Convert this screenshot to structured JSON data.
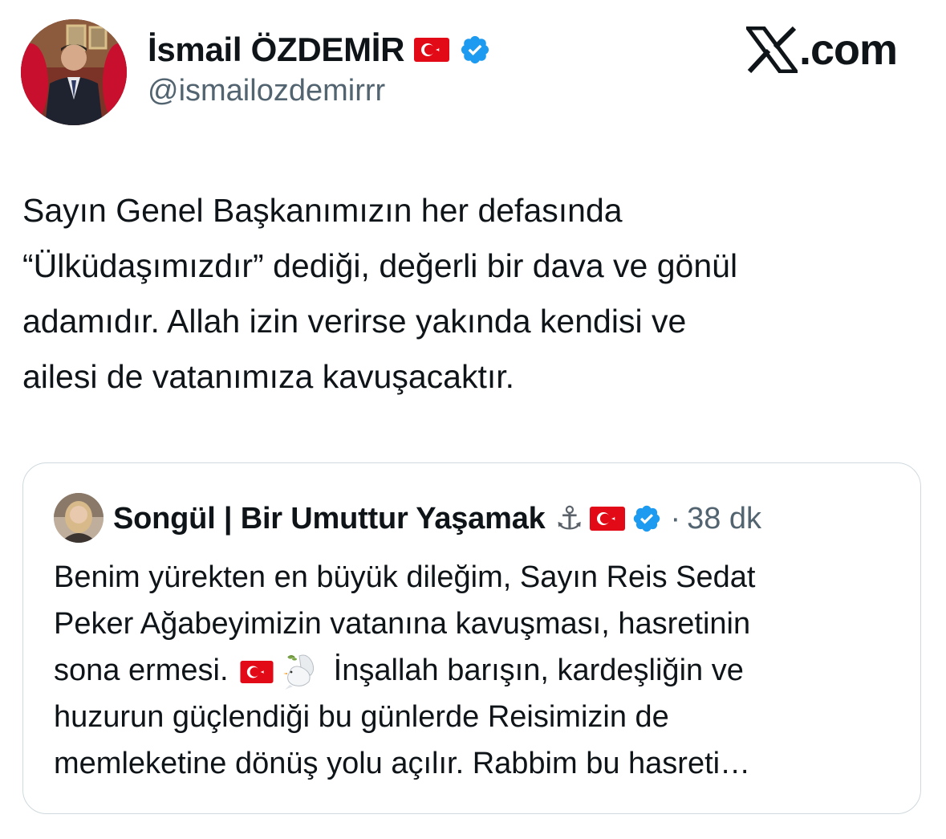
{
  "author": {
    "display_name": "İsmail ÖZDEMİR",
    "handle": "@ismailozdemirrr",
    "flag_icon": "turkey-flag-icon",
    "verified_icon": "verified-badge-icon",
    "verified_color": "#1d9bf0"
  },
  "brand": {
    "logo_icon": "x-logo-icon",
    "text": ".com"
  },
  "tweet": {
    "lines": [
      "Sayın Genel Başkanımızın her defasında",
      "“Ülküdaşımızdır” dediği, değerli bir dava ve gönül",
      "adamıdır. Allah izin verirse yakında kendisi ve",
      "ailesi de vatanımıza kavuşacaktır."
    ]
  },
  "quoted": {
    "display_name": "Songül | Bir Umuttur Yaşamak",
    "anchor_emoji": "⚓",
    "flag_icon": "turkey-flag-icon",
    "verified_icon": "verified-badge-icon",
    "separator": "·",
    "time": "38 dk",
    "line1": "Benim yürekten en büyük dileğim, Sayın Reis Sedat",
    "line2": "Peker Ağabeyimizin vatanına kavuşması, hasretinin",
    "line3_a": "sona ermesi.",
    "line3_emojis": [
      "turkey-flag-icon",
      "dove-icon"
    ],
    "line3_b": "İnşallah barışın, kardeşliğin ve",
    "line4": "huzurun güçlendiği bu günlerde Reisimizin de",
    "line5": "memleketine dönüş yolu açılır. Rabbim bu hasreti…"
  },
  "colors": {
    "text": "#0f1419",
    "secondary": "#536471",
    "border": "#cfd9de",
    "flag_red": "#e30a17"
  }
}
